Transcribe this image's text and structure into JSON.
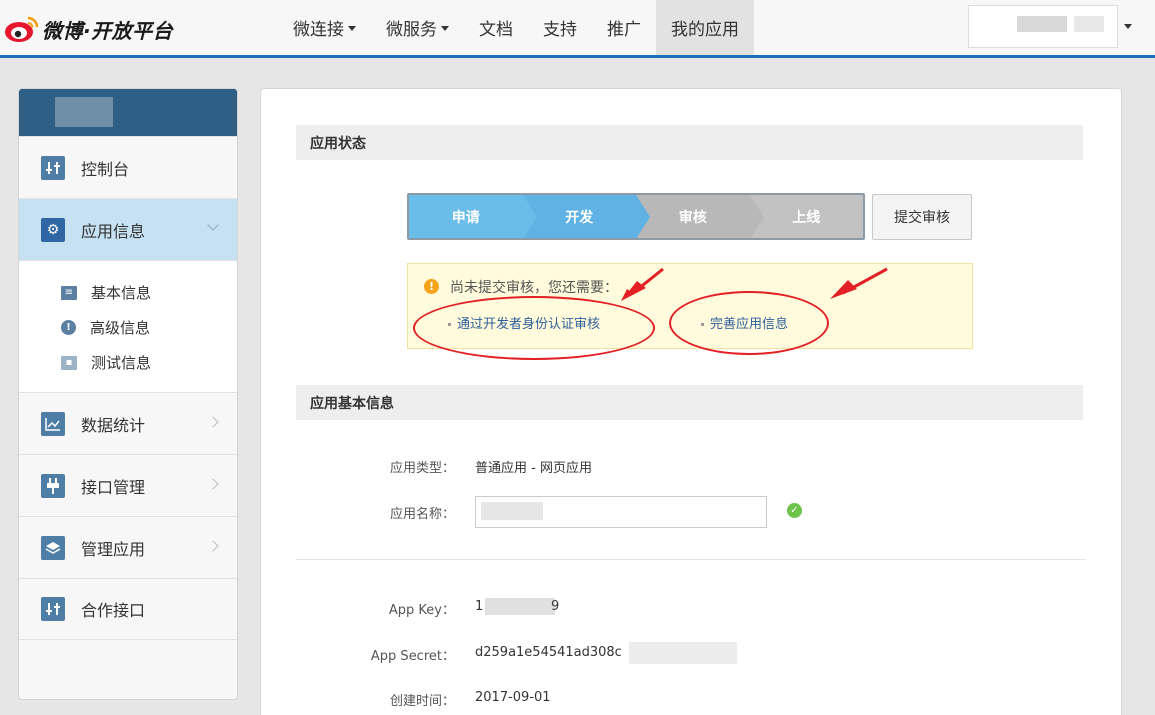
{
  "brand": {
    "name": "微博·开放平台"
  },
  "nav": {
    "items": [
      {
        "label": "微连接",
        "dropdown": true
      },
      {
        "label": "微服务",
        "dropdown": true
      },
      {
        "label": "文档",
        "dropdown": false
      },
      {
        "label": "支持",
        "dropdown": false
      },
      {
        "label": "推广",
        "dropdown": false
      },
      {
        "label": "我的应用",
        "dropdown": false,
        "active": true
      }
    ]
  },
  "sidebar": {
    "items": [
      {
        "label": "控制台",
        "icon": "sliders-icon"
      },
      {
        "label": "应用信息",
        "icon": "gear-icon",
        "active": true
      },
      {
        "label": "数据统计",
        "icon": "line-chart-icon"
      },
      {
        "label": "接口管理",
        "icon": "plug-icon"
      },
      {
        "label": "管理应用",
        "icon": "layers-icon"
      },
      {
        "label": "合作接口",
        "icon": "sliders-icon"
      }
    ],
    "sub_items": [
      {
        "label": "基本信息",
        "icon": "card-icon"
      },
      {
        "label": "高级信息",
        "icon": "info-icon"
      },
      {
        "label": "测试信息",
        "icon": "id-card-icon"
      }
    ]
  },
  "status_section": {
    "title": "应用状态",
    "steps": [
      "申请",
      "开发",
      "审核",
      "上线"
    ],
    "submit_label": "提交审核",
    "notice": {
      "text": "尚未提交审核，您还需要：",
      "link1": "通过开发者身份认证审核",
      "link2": "完善应用信息"
    }
  },
  "basic_section": {
    "title": "应用基本信息",
    "type_label": "应用类型：",
    "type_value": "普通应用 - 网页应用",
    "name_label": "应用名称：",
    "appkey_label": "App Key：",
    "appkey_prefix": "1",
    "appkey_suffix": "9",
    "secret_label": "App Secret：",
    "secret_value": "d259a1e54541ad308c",
    "created_label": "创建时间：",
    "created_value": "2017-09-01"
  },
  "colors": {
    "accent": "#1b6fb8",
    "step_active": "#6bbde9",
    "step_inactive": "#b8b8b8",
    "annotation": "#e32025"
  }
}
